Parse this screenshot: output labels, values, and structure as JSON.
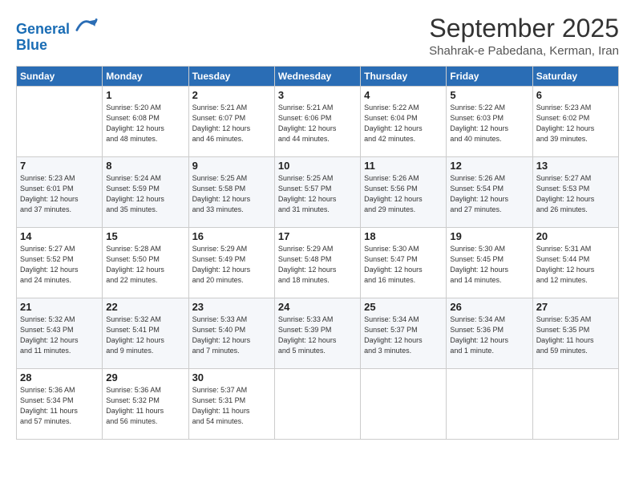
{
  "header": {
    "logo_line1": "General",
    "logo_line2": "Blue",
    "month": "September 2025",
    "location": "Shahrak-e Pabedana, Kerman, Iran"
  },
  "weekdays": [
    "Sunday",
    "Monday",
    "Tuesday",
    "Wednesday",
    "Thursday",
    "Friday",
    "Saturday"
  ],
  "weeks": [
    [
      {
        "day": "",
        "info": ""
      },
      {
        "day": "1",
        "info": "Sunrise: 5:20 AM\nSunset: 6:08 PM\nDaylight: 12 hours\nand 48 minutes."
      },
      {
        "day": "2",
        "info": "Sunrise: 5:21 AM\nSunset: 6:07 PM\nDaylight: 12 hours\nand 46 minutes."
      },
      {
        "day": "3",
        "info": "Sunrise: 5:21 AM\nSunset: 6:06 PM\nDaylight: 12 hours\nand 44 minutes."
      },
      {
        "day": "4",
        "info": "Sunrise: 5:22 AM\nSunset: 6:04 PM\nDaylight: 12 hours\nand 42 minutes."
      },
      {
        "day": "5",
        "info": "Sunrise: 5:22 AM\nSunset: 6:03 PM\nDaylight: 12 hours\nand 40 minutes."
      },
      {
        "day": "6",
        "info": "Sunrise: 5:23 AM\nSunset: 6:02 PM\nDaylight: 12 hours\nand 39 minutes."
      }
    ],
    [
      {
        "day": "7",
        "info": "Sunrise: 5:23 AM\nSunset: 6:01 PM\nDaylight: 12 hours\nand 37 minutes."
      },
      {
        "day": "8",
        "info": "Sunrise: 5:24 AM\nSunset: 5:59 PM\nDaylight: 12 hours\nand 35 minutes."
      },
      {
        "day": "9",
        "info": "Sunrise: 5:25 AM\nSunset: 5:58 PM\nDaylight: 12 hours\nand 33 minutes."
      },
      {
        "day": "10",
        "info": "Sunrise: 5:25 AM\nSunset: 5:57 PM\nDaylight: 12 hours\nand 31 minutes."
      },
      {
        "day": "11",
        "info": "Sunrise: 5:26 AM\nSunset: 5:56 PM\nDaylight: 12 hours\nand 29 minutes."
      },
      {
        "day": "12",
        "info": "Sunrise: 5:26 AM\nSunset: 5:54 PM\nDaylight: 12 hours\nand 27 minutes."
      },
      {
        "day": "13",
        "info": "Sunrise: 5:27 AM\nSunset: 5:53 PM\nDaylight: 12 hours\nand 26 minutes."
      }
    ],
    [
      {
        "day": "14",
        "info": "Sunrise: 5:27 AM\nSunset: 5:52 PM\nDaylight: 12 hours\nand 24 minutes."
      },
      {
        "day": "15",
        "info": "Sunrise: 5:28 AM\nSunset: 5:50 PM\nDaylight: 12 hours\nand 22 minutes."
      },
      {
        "day": "16",
        "info": "Sunrise: 5:29 AM\nSunset: 5:49 PM\nDaylight: 12 hours\nand 20 minutes."
      },
      {
        "day": "17",
        "info": "Sunrise: 5:29 AM\nSunset: 5:48 PM\nDaylight: 12 hours\nand 18 minutes."
      },
      {
        "day": "18",
        "info": "Sunrise: 5:30 AM\nSunset: 5:47 PM\nDaylight: 12 hours\nand 16 minutes."
      },
      {
        "day": "19",
        "info": "Sunrise: 5:30 AM\nSunset: 5:45 PM\nDaylight: 12 hours\nand 14 minutes."
      },
      {
        "day": "20",
        "info": "Sunrise: 5:31 AM\nSunset: 5:44 PM\nDaylight: 12 hours\nand 12 minutes."
      }
    ],
    [
      {
        "day": "21",
        "info": "Sunrise: 5:32 AM\nSunset: 5:43 PM\nDaylight: 12 hours\nand 11 minutes."
      },
      {
        "day": "22",
        "info": "Sunrise: 5:32 AM\nSunset: 5:41 PM\nDaylight: 12 hours\nand 9 minutes."
      },
      {
        "day": "23",
        "info": "Sunrise: 5:33 AM\nSunset: 5:40 PM\nDaylight: 12 hours\nand 7 minutes."
      },
      {
        "day": "24",
        "info": "Sunrise: 5:33 AM\nSunset: 5:39 PM\nDaylight: 12 hours\nand 5 minutes."
      },
      {
        "day": "25",
        "info": "Sunrise: 5:34 AM\nSunset: 5:37 PM\nDaylight: 12 hours\nand 3 minutes."
      },
      {
        "day": "26",
        "info": "Sunrise: 5:34 AM\nSunset: 5:36 PM\nDaylight: 12 hours\nand 1 minute."
      },
      {
        "day": "27",
        "info": "Sunrise: 5:35 AM\nSunset: 5:35 PM\nDaylight: 11 hours\nand 59 minutes."
      }
    ],
    [
      {
        "day": "28",
        "info": "Sunrise: 5:36 AM\nSunset: 5:34 PM\nDaylight: 11 hours\nand 57 minutes."
      },
      {
        "day": "29",
        "info": "Sunrise: 5:36 AM\nSunset: 5:32 PM\nDaylight: 11 hours\nand 56 minutes."
      },
      {
        "day": "30",
        "info": "Sunrise: 5:37 AM\nSunset: 5:31 PM\nDaylight: 11 hours\nand 54 minutes."
      },
      {
        "day": "",
        "info": ""
      },
      {
        "day": "",
        "info": ""
      },
      {
        "day": "",
        "info": ""
      },
      {
        "day": "",
        "info": ""
      }
    ]
  ]
}
